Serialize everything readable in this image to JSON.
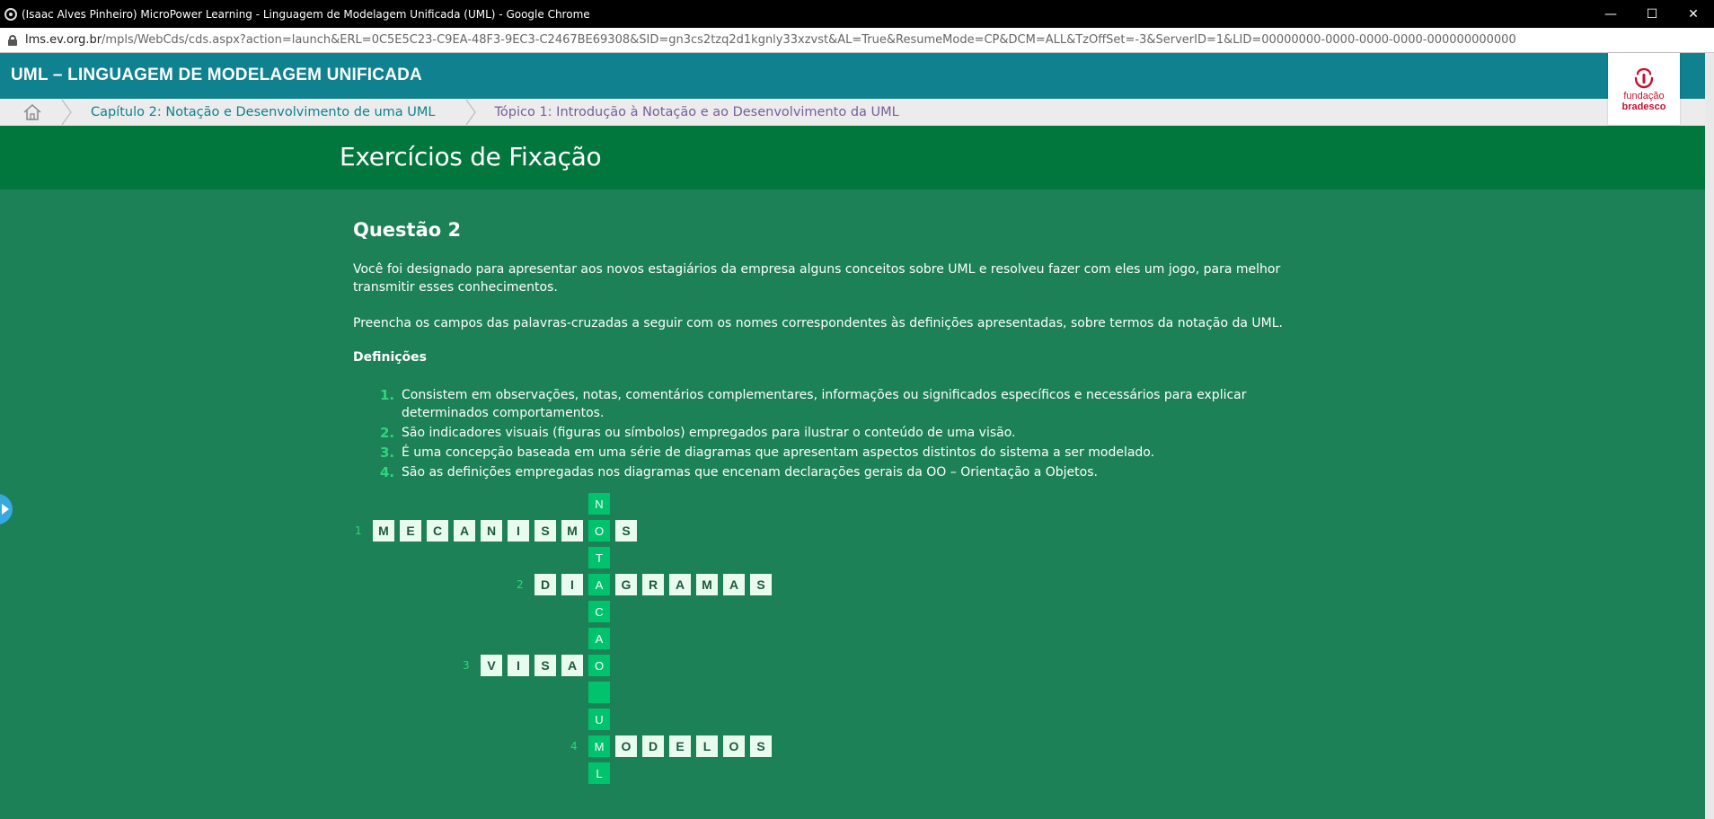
{
  "browser": {
    "window_title": "(Isaac Alves Pinheiro) MicroPower Learning - Linguagem de Modelagem Unificada (UML) - Google Chrome",
    "url_domain": "lms.ev.org.br",
    "url_path": "/mpls/WebCds/cds.aspx?action=launch&ERL=0C5E5C23-C9EA-48F3-9EC3-C2467BE69308&SID=gn3cs2tzq2d1kgnly33xzvst&AL=True&ResumeMode=CP&DCM=ALL&TzOffSet=-3&ServerID=1&LID=00000000-0000-0000-0000-000000000000",
    "minimize_glyph": "—",
    "maximize_glyph": "☐",
    "close_glyph": "✕"
  },
  "header": {
    "title": "UML – LINGUAGEM DE MODELAGEM UNIFICADA",
    "logo": {
      "line1": "fundação",
      "line2": "bradesco",
      "color": "#c8102e"
    }
  },
  "breadcrumb": {
    "items": [
      {
        "label": "Capítulo 2: Notação e Desenvolvimento de uma UML"
      },
      {
        "label": "Tópico 1: Introdução à Notação e ao Desenvolvimento da UML"
      }
    ]
  },
  "page": {
    "title": "Exercícios de Fixação"
  },
  "question": {
    "title": "Questão 2",
    "paragraph1": "Você foi designado para apresentar aos novos estagiários da empresa alguns conceitos sobre UML e resolveu fazer com eles um jogo, para melhor transmitir esses conhecimentos.",
    "paragraph2": "Preencha os campos das palavras-cruzadas a seguir com os nomes correspondentes às definições apresentadas, sobre termos da notação da UML.",
    "definitions_title": "Definições",
    "definitions": [
      {
        "num": "1.",
        "text": "Consistem em observações, notas, comentários complementares, informações ou significados específicos e necessários para explicar determinados comportamentos."
      },
      {
        "num": "2.",
        "text": "São indicadores visuais (figuras ou símbolos) empregados para ilustrar o conteúdo de uma visão."
      },
      {
        "num": "3.",
        "text": "É uma concepção baseada em uma série de diagramas que apresentam aspectos distintos do sistema a ser modelado."
      },
      {
        "num": "4.",
        "text": "São as definições empregadas nos diagramas que encenam declarações gerais da OO – Orientação a Objetos."
      }
    ]
  },
  "crossword": {
    "vertical": {
      "letters": [
        "N",
        "O",
        "T",
        "A",
        "C",
        "A",
        "O",
        "",
        "U",
        "M",
        "L"
      ]
    },
    "rows": [
      {
        "clue": "1",
        "letters": [
          "M",
          "E",
          "C",
          "A",
          "N",
          "I",
          "S",
          "M",
          "O",
          "S"
        ]
      },
      {
        "clue": "2",
        "letters": [
          "D",
          "I",
          "A",
          "G",
          "R",
          "A",
          "M",
          "A",
          "S"
        ]
      },
      {
        "clue": "3",
        "letters": [
          "V",
          "I",
          "S",
          "A",
          "O"
        ]
      },
      {
        "clue": "4",
        "letters": [
          "M",
          "O",
          "D",
          "E",
          "L",
          "O",
          "S"
        ]
      }
    ]
  },
  "colors": {
    "page_bg": "#1c8157",
    "band_bg": "#01773d",
    "header_bg": "#0f818f",
    "accent_green": "#2fd67b",
    "vertical_cell": "#01c36e"
  }
}
